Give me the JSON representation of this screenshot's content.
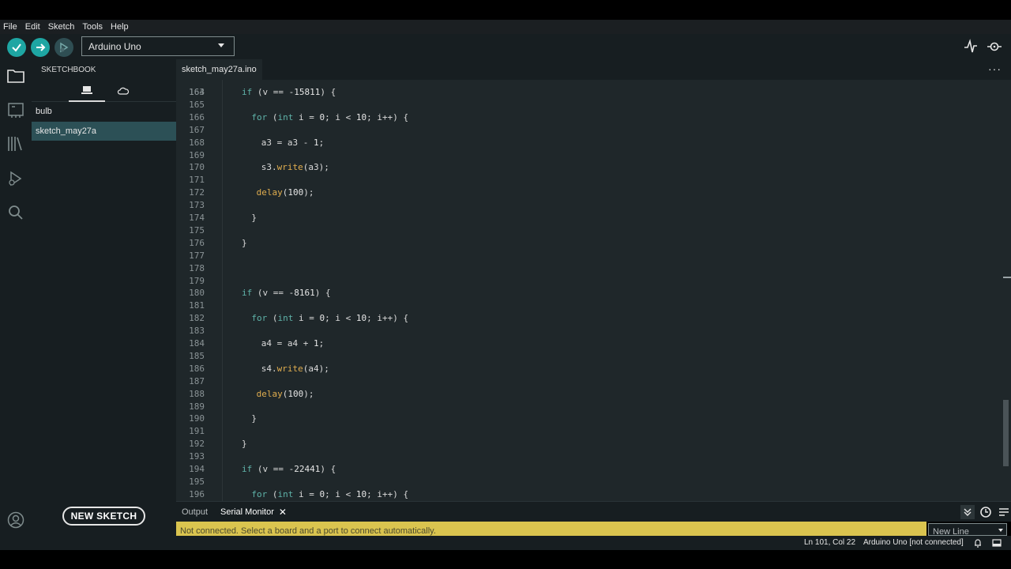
{
  "menu": [
    "File",
    "Edit",
    "Sketch",
    "Tools",
    "Help"
  ],
  "toolbar": {
    "board": "Arduino Uno"
  },
  "sidebar": {
    "title": "SKETCHBOOK",
    "items": [
      "bulb",
      "sketch_may27a"
    ],
    "new_sketch": "NEW SKETCH"
  },
  "editor": {
    "tab": "sketch_may27a.ino",
    "partial_line_number": "163",
    "lines": [
      {
        "n": "164",
        "indent": 2,
        "tokens": [
          [
            "kw",
            "if"
          ],
          [
            "t",
            " (v == "
          ],
          [
            "num",
            "-15811"
          ],
          [
            "t",
            ") {"
          ]
        ]
      },
      {
        "n": "165",
        "indent": 0,
        "tokens": []
      },
      {
        "n": "166",
        "indent": 3,
        "tokens": [
          [
            "kw",
            "for"
          ],
          [
            "t",
            " ("
          ],
          [
            "ty",
            "int"
          ],
          [
            "t",
            " i = "
          ],
          [
            "num",
            "0"
          ],
          [
            "t",
            "; i < "
          ],
          [
            "num",
            "10"
          ],
          [
            "t",
            "; i++) {"
          ]
        ]
      },
      {
        "n": "167",
        "indent": 0,
        "tokens": []
      },
      {
        "n": "168",
        "indent": 4,
        "tokens": [
          [
            "t",
            "a3 = a3 - "
          ],
          [
            "num",
            "1"
          ],
          [
            "t",
            ";"
          ]
        ]
      },
      {
        "n": "169",
        "indent": 0,
        "tokens": []
      },
      {
        "n": "170",
        "indent": 4,
        "tokens": [
          [
            "t",
            "s3."
          ],
          [
            "fn",
            "write"
          ],
          [
            "t",
            "(a3);"
          ]
        ]
      },
      {
        "n": "171",
        "indent": 0,
        "tokens": []
      },
      {
        "n": "172",
        "indent": 3.5,
        "tokens": [
          [
            "fn",
            "delay"
          ],
          [
            "t",
            "("
          ],
          [
            "num",
            "100"
          ],
          [
            "t",
            ");"
          ]
        ]
      },
      {
        "n": "173",
        "indent": 0,
        "tokens": []
      },
      {
        "n": "174",
        "indent": 3,
        "tokens": [
          [
            "t",
            "}"
          ]
        ]
      },
      {
        "n": "175",
        "indent": 0,
        "tokens": []
      },
      {
        "n": "176",
        "indent": 2,
        "tokens": [
          [
            "t",
            "}"
          ]
        ]
      },
      {
        "n": "177",
        "indent": 0,
        "tokens": []
      },
      {
        "n": "178",
        "indent": 0,
        "tokens": []
      },
      {
        "n": "179",
        "indent": 0,
        "tokens": []
      },
      {
        "n": "180",
        "indent": 2,
        "tokens": [
          [
            "kw",
            "if"
          ],
          [
            "t",
            " (v == "
          ],
          [
            "num",
            "-8161"
          ],
          [
            "t",
            ") {"
          ]
        ]
      },
      {
        "n": "181",
        "indent": 0,
        "tokens": []
      },
      {
        "n": "182",
        "indent": 3,
        "tokens": [
          [
            "kw",
            "for"
          ],
          [
            "t",
            " ("
          ],
          [
            "ty",
            "int"
          ],
          [
            "t",
            " i = "
          ],
          [
            "num",
            "0"
          ],
          [
            "t",
            "; i < "
          ],
          [
            "num",
            "10"
          ],
          [
            "t",
            "; i++) {"
          ]
        ]
      },
      {
        "n": "183",
        "indent": 0,
        "tokens": []
      },
      {
        "n": "184",
        "indent": 4,
        "tokens": [
          [
            "t",
            "a4 = a4 + "
          ],
          [
            "num",
            "1"
          ],
          [
            "t",
            ";"
          ]
        ]
      },
      {
        "n": "185",
        "indent": 0,
        "tokens": []
      },
      {
        "n": "186",
        "indent": 4,
        "tokens": [
          [
            "t",
            "s4."
          ],
          [
            "fn",
            "write"
          ],
          [
            "t",
            "(a4);"
          ]
        ]
      },
      {
        "n": "187",
        "indent": 0,
        "tokens": []
      },
      {
        "n": "188",
        "indent": 3.5,
        "tokens": [
          [
            "fn",
            "delay"
          ],
          [
            "t",
            "("
          ],
          [
            "num",
            "100"
          ],
          [
            "t",
            ");"
          ]
        ]
      },
      {
        "n": "189",
        "indent": 0,
        "tokens": []
      },
      {
        "n": "190",
        "indent": 3,
        "tokens": [
          [
            "t",
            "}"
          ]
        ]
      },
      {
        "n": "191",
        "indent": 0,
        "tokens": []
      },
      {
        "n": "192",
        "indent": 2,
        "tokens": [
          [
            "t",
            "}"
          ]
        ]
      },
      {
        "n": "193",
        "indent": 0,
        "tokens": []
      },
      {
        "n": "194",
        "indent": 2,
        "tokens": [
          [
            "kw",
            "if"
          ],
          [
            "t",
            " (v == "
          ],
          [
            "num",
            "-22441"
          ],
          [
            "t",
            ") {"
          ]
        ]
      },
      {
        "n": "195",
        "indent": 0,
        "tokens": []
      },
      {
        "n": "196",
        "indent": 3,
        "tokens": [
          [
            "kw",
            "for"
          ],
          [
            "t",
            " ("
          ],
          [
            "ty",
            "int"
          ],
          [
            "t",
            " i = "
          ],
          [
            "num",
            "0"
          ],
          [
            "t",
            "; i < "
          ],
          [
            "num",
            "10"
          ],
          [
            "t",
            "; i++) {"
          ]
        ]
      }
    ]
  },
  "panel": {
    "output_tab": "Output",
    "serial_tab": "Serial Monitor",
    "notice": "Not connected. Select a board and a port to connect automatically.",
    "line_ending": "New Line"
  },
  "status": {
    "position": "Ln 101, Col 22",
    "board": "Arduino Uno [not connected]"
  },
  "colors": {
    "accent": "#1ea6a3",
    "editor_bg": "#1f272a",
    "sidebar_bg": "#171e21",
    "selected_item": "#2c5056",
    "notice_bg": "#dac44f",
    "keyword": "#5fb3a9",
    "function": "#e1ae4f"
  }
}
